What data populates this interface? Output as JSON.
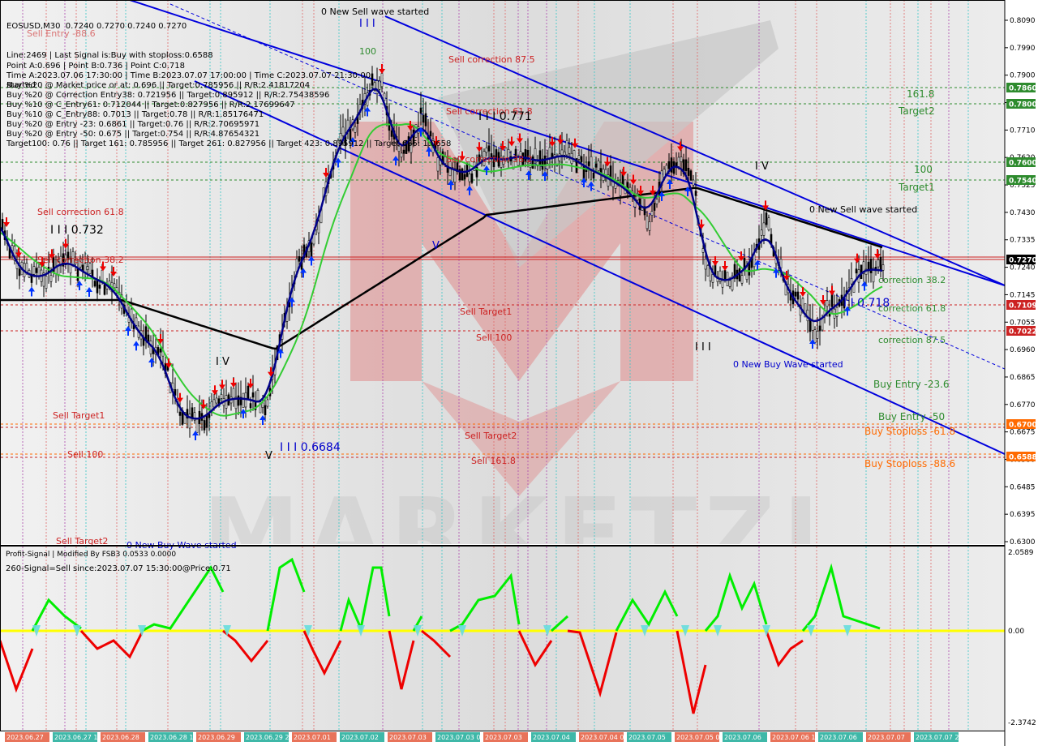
{
  "header": {
    "symbol_line": "EOSUSD,M30  0.7240 0.7270 0.7240 0.7270",
    "info_lines": [
      "Line:2469 | Last Signal is:Buy with stoploss:0.6588",
      "Point A:0.696 | Point B:0.736 | Point C:0.718",
      "Time A:2023.07.06 17:30:00 | Time B:2023.07.07 17:00:00 | Time C:2023.07.07 21:30:00",
      "Buy %20 @ Market price or at: 0.696 || Target:0.785956 || R/R:2.41817204",
      "Buy %20 @ Correction Entry38: 0.721956 || Target:0.895912 || R/R:2.75438596",
      "Buy %10 @ C_Entry61: 0.712044 || Target:0.827956 || R/R:2.17699647",
      "Buy %10 @ C_Entry88: 0.7013 || Target:0.78 || R/R:1.85176471",
      "Buy %20 @ Entry -23: 0.6861 || Target:0.76 || R/R:2.70695971",
      "Buy %20 @ Entry -50: 0.675 || Target:0.754 || R/R:4.87654321",
      "Target100: 0.76 || Target 161: 0.785956 || Target 261: 0.827956 || Target 423: 0.895912 || Target 685: 1.0658"
    ],
    "started_word": "started"
  },
  "price_axis": {
    "ticks": [
      "0.8090",
      "0.7990",
      "0.7900",
      "0.7805",
      "0.7710",
      "0.7620",
      "0.7525",
      "0.7430",
      "0.7335",
      "0.7240",
      "0.7145",
      "0.7055",
      "0.6960",
      "0.6865",
      "0.6770",
      "0.6675",
      "0.6580",
      "0.6485",
      "0.6395",
      "0.6300"
    ],
    "badges": [
      {
        "label": "0.7860",
        "color": "#2e8b2e"
      },
      {
        "label": "0.7800",
        "color": "#2e8b2e"
      },
      {
        "label": "0.7600",
        "color": "#2e8b2e"
      },
      {
        "label": "0.7540",
        "color": "#2e8b2e"
      },
      {
        "label": "0.7270",
        "color": "#000000"
      },
      {
        "label": "0.7109",
        "color": "#cc2222"
      },
      {
        "label": "0.7022",
        "color": "#cc2222"
      },
      {
        "label": "0.6700",
        "color": "#ff6a00"
      },
      {
        "label": "0.6588",
        "color": "#ff6a00"
      }
    ]
  },
  "osc_axis": {
    "ticks": [
      "2.0589",
      "0.00",
      "-2.3742"
    ]
  },
  "oscillator": {
    "title": "Profit-Signal | Modified By FSB3 0.0533 0.0000",
    "signal_text": "260-Signal=Sell since:2023.07.07 15:30:00@Price:0.71"
  },
  "time_axis": {
    "labels": [
      "2023.06.27",
      "2023.06.27 17:00",
      "2023.06.28",
      "2023.06.28 18:30",
      "2023.06.29",
      "2023.06.29 23:00",
      "2023.07.01",
      "2023.07.02",
      "2023.07.03",
      "2023.07.03 03:00",
      "2023.07.03",
      "2023.07.04",
      "2023.07.04 04:00",
      "2023.07.05",
      "2023.07.05 09:00",
      "2023.07.06",
      "2023.07.06 11:00",
      "2023.07.06",
      "2023.07.07",
      "2023.07.07 23:00"
    ]
  },
  "annotations": {
    "sell_wave_top": "0 New Sell wave started",
    "sell_wave_right": "0 New Sell wave started",
    "buy_wave_right": "0 New Buy Wave started",
    "buy_wave_bottom": "0 New Buy Wave started",
    "sell_correction_875": "Sell correction 87.5",
    "sell_correction_618_top": "Sell correction 61.8",
    "sell_correction_382_top": "Sell correction 38.2",
    "sell_correction_618_left": "Sell correction 61.8",
    "sell_correction_382_left": "Sell correction 38.2",
    "sell_target1_mid": "Sell Target1",
    "sell_100_mid": "Sell 100",
    "sell_target2_mid": "Sell Target2",
    "sell_1618_mid": "Sell 161.8",
    "sell_target1_left": "Sell Target1",
    "sell_100_left": "Sell 100",
    "sell_target2_left": "Sell Target2",
    "sell_entry_left": "Sell Entry -88.6",
    "wave_label_0732": "I I I 0.732",
    "wave_label_0771": "I I I 0.771",
    "wave_label_06684": "I I I 0.6684",
    "wave_label_0718": "I I 0.718",
    "label_100_top": "100",
    "label_IV_left": "I V",
    "label_V_left": "V",
    "label_V_mid": "V",
    "label_IV_right": "I V",
    "label_III_right": "I I I",
    "label_III_top": "I I I",
    "target_1618": "161.8",
    "target2": "Target2",
    "target_100": "100",
    "target1": "Target1",
    "correction_382": "correction 38.2",
    "correction_618": "correction 61.8",
    "correction_875": "correction 87.5",
    "buy_entry_236": "Buy Entry -23.6",
    "buy_entry_50": "Buy Entry -50",
    "buy_stoploss_618": "Buy Stoploss -61.8",
    "buy_stoploss_886": "Buy Stoploss -88.6"
  },
  "watermark_text": "MARKETZI",
  "colors": {
    "sell": "#cc2222",
    "target": "#2e8b2e",
    "stoploss": "#ff6a00",
    "channel": "#0000dd",
    "osc_positive": "#00ee00",
    "osc_negative": "#ee0000",
    "zero_line": "#ffff00"
  },
  "chart_data": {
    "type": "line",
    "symbol": "EOSUSD",
    "timeframe": "M30",
    "ohlc_last": {
      "open": 0.724,
      "high": 0.727,
      "low": 0.724,
      "close": 0.727
    },
    "price_ylim": [
      0.63,
      0.809
    ],
    "horizontal_levels": [
      {
        "label": "161.8",
        "value": 0.786
      },
      {
        "label": "Target2",
        "value": 0.78
      },
      {
        "label": "100",
        "value": 0.76
      },
      {
        "label": "Target1",
        "value": 0.754
      },
      {
        "label": "correction 38.2",
        "value": 0.727
      },
      {
        "label": "correction 61.8",
        "value": 0.7109
      },
      {
        "label": "correction 87.5",
        "value": 0.7022
      },
      {
        "label": "Buy Entry -23.6",
        "value": 0.6861
      },
      {
        "label": "Buy Entry -50",
        "value": 0.675
      },
      {
        "label": "Buy Stoploss -61.8",
        "value": 0.67
      },
      {
        "label": "Buy Stoploss -88.6",
        "value": 0.6588
      }
    ],
    "oscillator_ylim": [
      -2.3742,
      2.0589
    ]
  }
}
